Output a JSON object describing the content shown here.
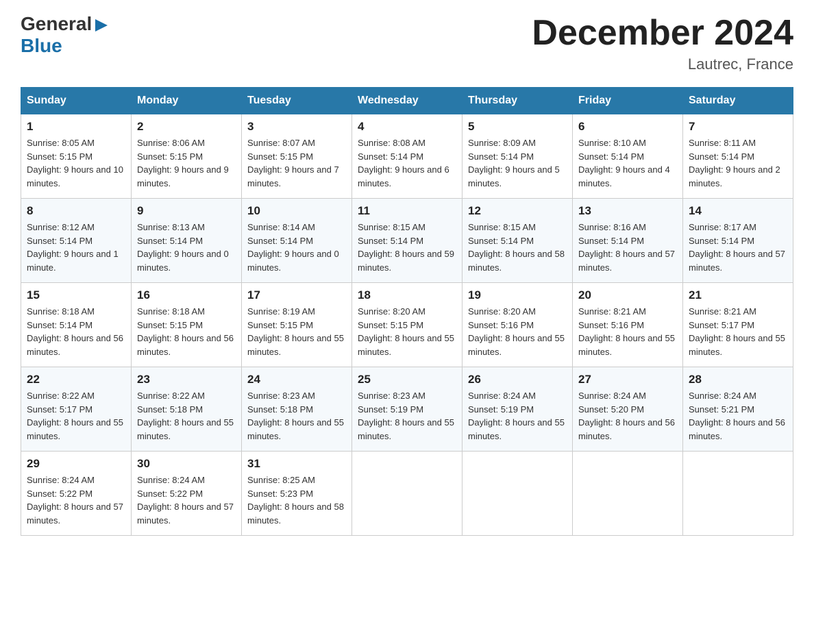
{
  "header": {
    "logo_line1": "General",
    "logo_line2": "Blue",
    "month_title": "December 2024",
    "location": "Lautrec, France"
  },
  "days_of_week": [
    "Sunday",
    "Monday",
    "Tuesday",
    "Wednesday",
    "Thursday",
    "Friday",
    "Saturday"
  ],
  "weeks": [
    [
      {
        "day": "1",
        "sunrise": "8:05 AM",
        "sunset": "5:15 PM",
        "daylight": "9 hours and 10 minutes."
      },
      {
        "day": "2",
        "sunrise": "8:06 AM",
        "sunset": "5:15 PM",
        "daylight": "9 hours and 9 minutes."
      },
      {
        "day": "3",
        "sunrise": "8:07 AM",
        "sunset": "5:15 PM",
        "daylight": "9 hours and 7 minutes."
      },
      {
        "day": "4",
        "sunrise": "8:08 AM",
        "sunset": "5:14 PM",
        "daylight": "9 hours and 6 minutes."
      },
      {
        "day": "5",
        "sunrise": "8:09 AM",
        "sunset": "5:14 PM",
        "daylight": "9 hours and 5 minutes."
      },
      {
        "day": "6",
        "sunrise": "8:10 AM",
        "sunset": "5:14 PM",
        "daylight": "9 hours and 4 minutes."
      },
      {
        "day": "7",
        "sunrise": "8:11 AM",
        "sunset": "5:14 PM",
        "daylight": "9 hours and 2 minutes."
      }
    ],
    [
      {
        "day": "8",
        "sunrise": "8:12 AM",
        "sunset": "5:14 PM",
        "daylight": "9 hours and 1 minute."
      },
      {
        "day": "9",
        "sunrise": "8:13 AM",
        "sunset": "5:14 PM",
        "daylight": "9 hours and 0 minutes."
      },
      {
        "day": "10",
        "sunrise": "8:14 AM",
        "sunset": "5:14 PM",
        "daylight": "9 hours and 0 minutes."
      },
      {
        "day": "11",
        "sunrise": "8:15 AM",
        "sunset": "5:14 PM",
        "daylight": "8 hours and 59 minutes."
      },
      {
        "day": "12",
        "sunrise": "8:15 AM",
        "sunset": "5:14 PM",
        "daylight": "8 hours and 58 minutes."
      },
      {
        "day": "13",
        "sunrise": "8:16 AM",
        "sunset": "5:14 PM",
        "daylight": "8 hours and 57 minutes."
      },
      {
        "day": "14",
        "sunrise": "8:17 AM",
        "sunset": "5:14 PM",
        "daylight": "8 hours and 57 minutes."
      }
    ],
    [
      {
        "day": "15",
        "sunrise": "8:18 AM",
        "sunset": "5:14 PM",
        "daylight": "8 hours and 56 minutes."
      },
      {
        "day": "16",
        "sunrise": "8:18 AM",
        "sunset": "5:15 PM",
        "daylight": "8 hours and 56 minutes."
      },
      {
        "day": "17",
        "sunrise": "8:19 AM",
        "sunset": "5:15 PM",
        "daylight": "8 hours and 55 minutes."
      },
      {
        "day": "18",
        "sunrise": "8:20 AM",
        "sunset": "5:15 PM",
        "daylight": "8 hours and 55 minutes."
      },
      {
        "day": "19",
        "sunrise": "8:20 AM",
        "sunset": "5:16 PM",
        "daylight": "8 hours and 55 minutes."
      },
      {
        "day": "20",
        "sunrise": "8:21 AM",
        "sunset": "5:16 PM",
        "daylight": "8 hours and 55 minutes."
      },
      {
        "day": "21",
        "sunrise": "8:21 AM",
        "sunset": "5:17 PM",
        "daylight": "8 hours and 55 minutes."
      }
    ],
    [
      {
        "day": "22",
        "sunrise": "8:22 AM",
        "sunset": "5:17 PM",
        "daylight": "8 hours and 55 minutes."
      },
      {
        "day": "23",
        "sunrise": "8:22 AM",
        "sunset": "5:18 PM",
        "daylight": "8 hours and 55 minutes."
      },
      {
        "day": "24",
        "sunrise": "8:23 AM",
        "sunset": "5:18 PM",
        "daylight": "8 hours and 55 minutes."
      },
      {
        "day": "25",
        "sunrise": "8:23 AM",
        "sunset": "5:19 PM",
        "daylight": "8 hours and 55 minutes."
      },
      {
        "day": "26",
        "sunrise": "8:24 AM",
        "sunset": "5:19 PM",
        "daylight": "8 hours and 55 minutes."
      },
      {
        "day": "27",
        "sunrise": "8:24 AM",
        "sunset": "5:20 PM",
        "daylight": "8 hours and 56 minutes."
      },
      {
        "day": "28",
        "sunrise": "8:24 AM",
        "sunset": "5:21 PM",
        "daylight": "8 hours and 56 minutes."
      }
    ],
    [
      {
        "day": "29",
        "sunrise": "8:24 AM",
        "sunset": "5:22 PM",
        "daylight": "8 hours and 57 minutes."
      },
      {
        "day": "30",
        "sunrise": "8:24 AM",
        "sunset": "5:22 PM",
        "daylight": "8 hours and 57 minutes."
      },
      {
        "day": "31",
        "sunrise": "8:25 AM",
        "sunset": "5:23 PM",
        "daylight": "8 hours and 58 minutes."
      },
      null,
      null,
      null,
      null
    ]
  ],
  "labels": {
    "sunrise": "Sunrise:",
    "sunset": "Sunset:",
    "daylight": "Daylight:"
  }
}
